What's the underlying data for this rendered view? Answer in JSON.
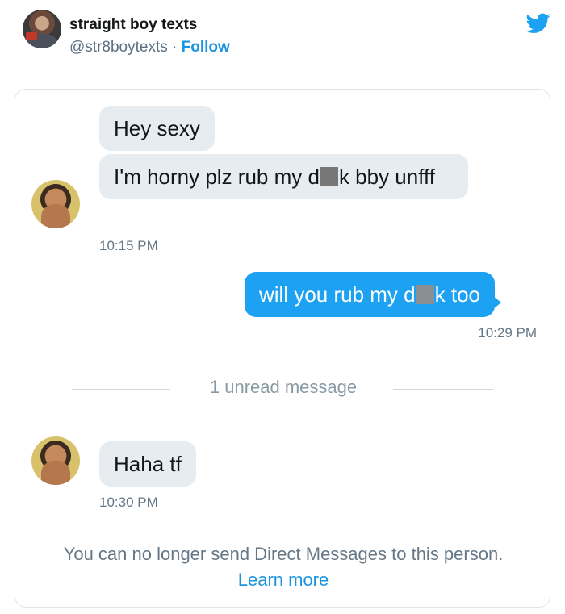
{
  "tweet": {
    "account_name": "straight boy texts",
    "handle": "@str8boytexts",
    "separator": " · ",
    "follow_label": "Follow"
  },
  "conversation": {
    "messages_in_1": [
      {
        "text": "Hey sexy"
      },
      {
        "text_before": "I'm horny plz rub my d",
        "text_after": "k bby unfff"
      }
    ],
    "time_1": "10:15 PM",
    "message_out": {
      "text_before": "will you rub my d",
      "text_after": "k too"
    },
    "time_out": "10:29 PM",
    "unread_divider": "1 unread message",
    "message_in_2": "Haha tf",
    "time_2": "10:30 PM",
    "notice_text": "You can no longer send Direct Messages to this person.",
    "learn_more": "Learn more"
  },
  "icons": {
    "brand": "twitter-bird-icon",
    "brand_color": "#1da1f2",
    "outgoing_bubble_color": "#1da1f2",
    "incoming_bubble_color": "#e6ecf0"
  }
}
